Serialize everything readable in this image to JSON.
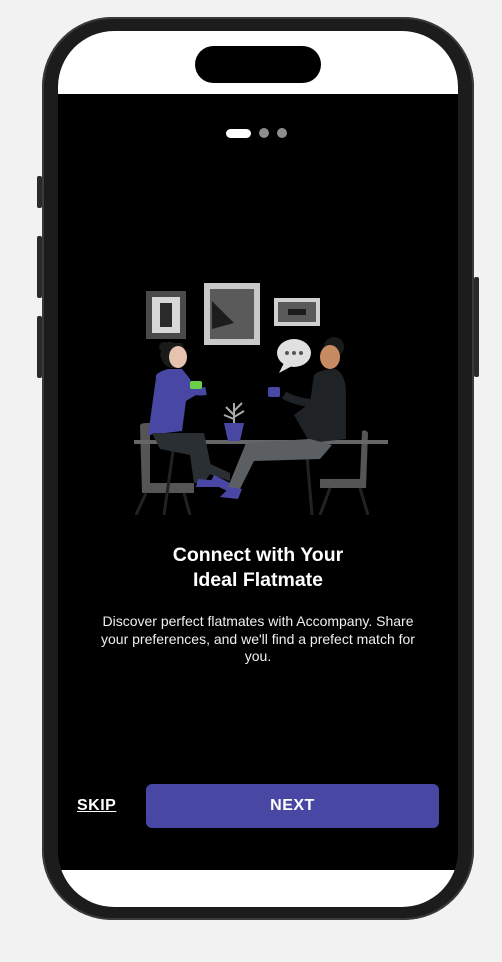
{
  "onboarding": {
    "pager": {
      "total": 3,
      "active_index": 0
    },
    "title": "Connect with Your\nIdeal Flatmate",
    "description": "Discover perfect flatmates with Accompany. Share your preferences, and we'll find a prefect match for you.",
    "skip_label": "SKIP",
    "next_label": "NEXT"
  },
  "colors": {
    "accent": "#4848a4",
    "background": "#000000",
    "text": "#ffffff"
  },
  "icons": [
    "flatmates-illustration"
  ]
}
